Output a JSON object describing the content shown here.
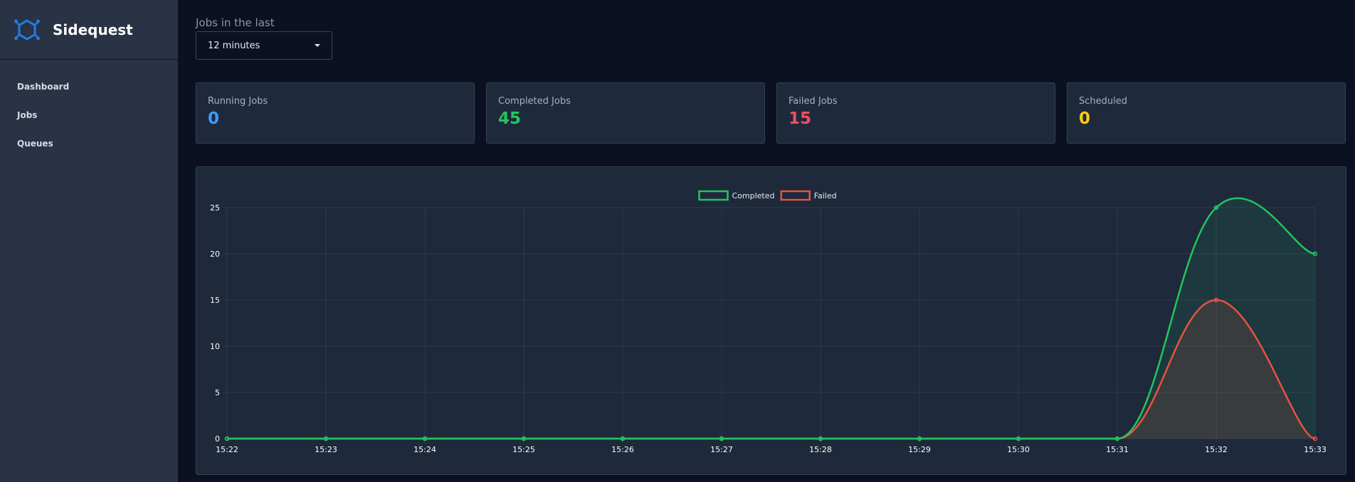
{
  "app": {
    "name": "Sidequest"
  },
  "sidebar": {
    "items": [
      {
        "label": "Dashboard"
      },
      {
        "label": "Jobs"
      },
      {
        "label": "Queues"
      }
    ]
  },
  "filters": {
    "range_label": "Jobs in the last",
    "range_value": "12 minutes"
  },
  "stats": [
    {
      "title": "Running Jobs",
      "value": "0",
      "color": "#3b9cff"
    },
    {
      "title": "Completed Jobs",
      "value": "45",
      "color": "#22c55e"
    },
    {
      "title": "Failed Jobs",
      "value": "15",
      "color": "#ef4f5f"
    },
    {
      "title": "Scheduled",
      "value": "0",
      "color": "#facc15"
    }
  ],
  "chart_data": {
    "type": "line",
    "x": [
      "15:22",
      "15:23",
      "15:24",
      "15:25",
      "15:26",
      "15:27",
      "15:28",
      "15:29",
      "15:30",
      "15:31",
      "15:32",
      "15:33"
    ],
    "series": [
      {
        "name": "Completed",
        "values": [
          0,
          0,
          0,
          0,
          0,
          0,
          0,
          0,
          0,
          0,
          25,
          20
        ],
        "color": "#22c55e"
      },
      {
        "name": "Failed",
        "values": [
          0,
          0,
          0,
          0,
          0,
          0,
          0,
          0,
          0,
          0,
          15,
          0
        ],
        "color": "#e5533f"
      }
    ],
    "yticks": [
      0,
      5,
      10,
      15,
      20,
      25
    ],
    "ylim": [
      0,
      25
    ],
    "grid": true,
    "legend": "top-center",
    "area_fill": true
  }
}
